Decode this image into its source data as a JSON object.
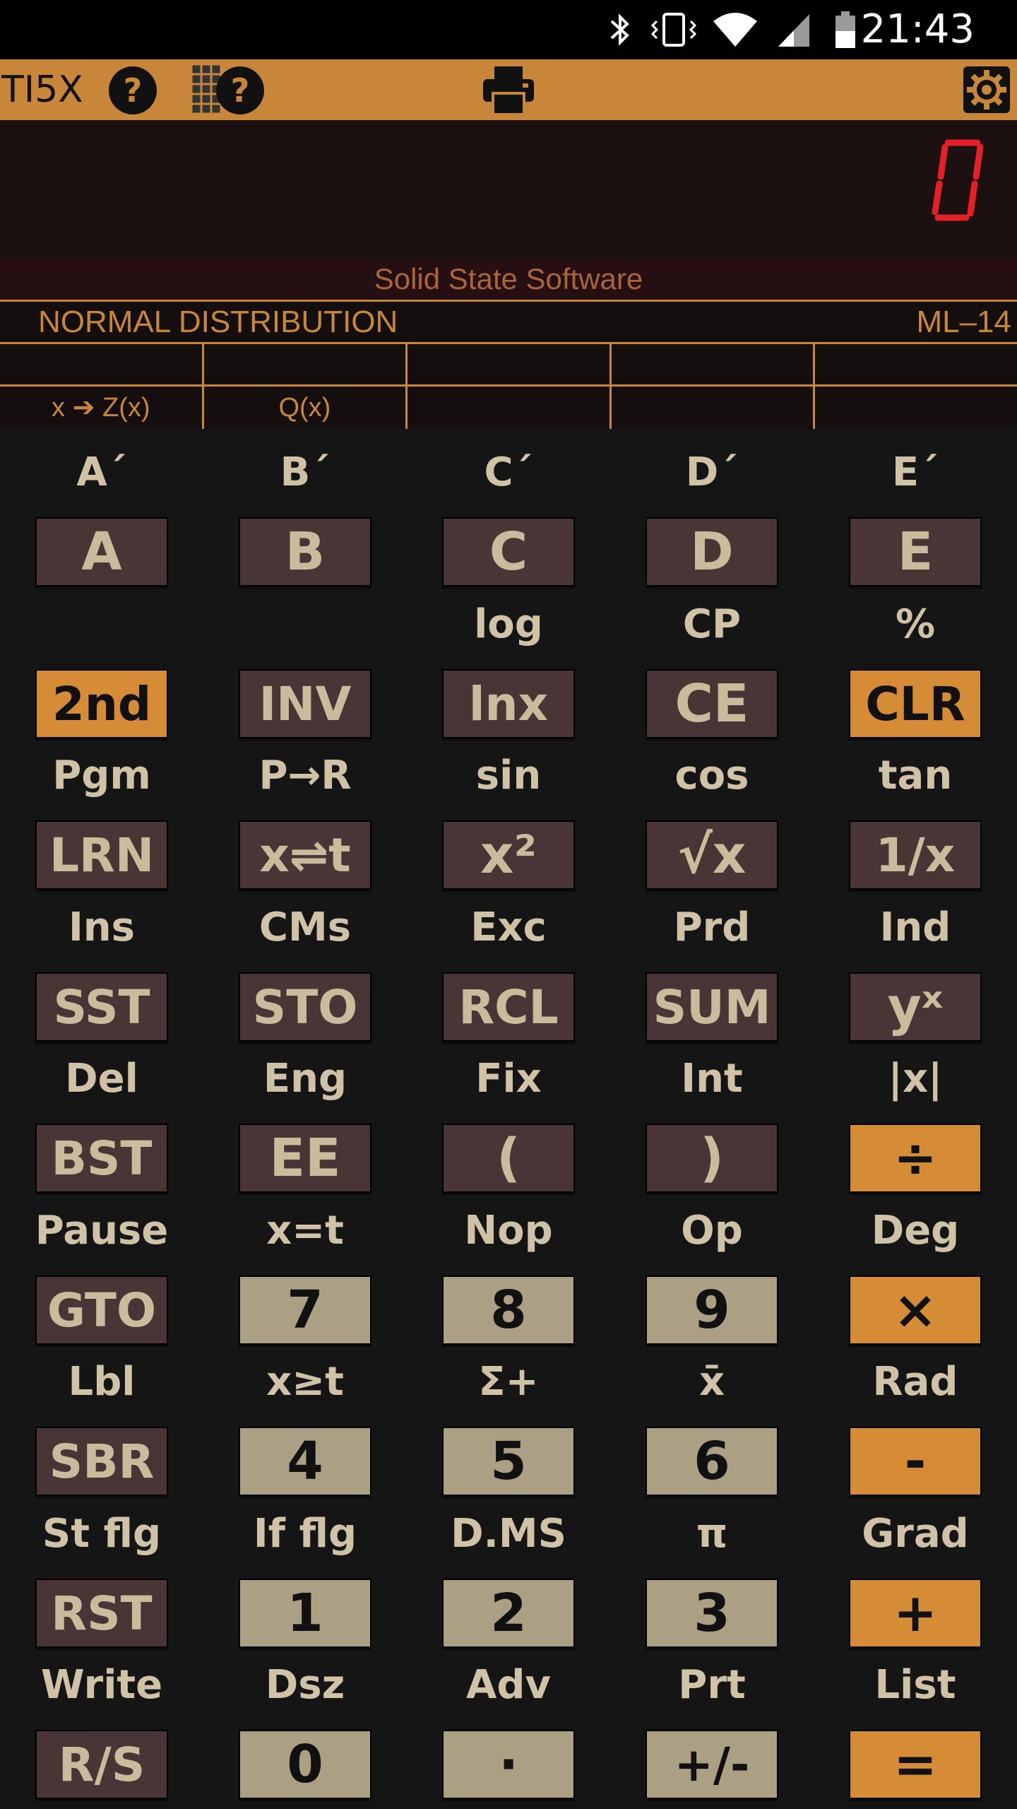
{
  "status_bar": {
    "time": "21:43",
    "icons": [
      "bluetooth-icon",
      "vibrate-icon",
      "wifi-icon",
      "cell-signal-icon",
      "battery-icon"
    ]
  },
  "toolbar": {
    "app_name": "TI5X",
    "icons": [
      "help-icon",
      "keypad-help-icon",
      "print-icon",
      "gear-icon"
    ]
  },
  "display": {
    "value": "0",
    "digit_color": "#e3202a"
  },
  "brand": "Solid State Software",
  "label_strip": {
    "title": "NORMAL DISTRIBUTION",
    "code": "ML–14",
    "row1": [
      "",
      "",
      "",
      "",
      ""
    ],
    "row2": [
      "x ➔ Z(x)",
      "Q(x)",
      "",
      "",
      ""
    ]
  },
  "keypad": {
    "rows": [
      {
        "labels": [
          "A´",
          "B´",
          "C´",
          "D´",
          "E´"
        ],
        "keys": [
          {
            "t": "A",
            "s": "dark"
          },
          {
            "t": "B",
            "s": "dark"
          },
          {
            "t": "C",
            "s": "dark"
          },
          {
            "t": "D",
            "s": "dark"
          },
          {
            "t": "E",
            "s": "dark"
          }
        ]
      },
      {
        "labels": [
          "",
          "",
          "log",
          "CP",
          "%"
        ],
        "keys": [
          {
            "t": "2nd",
            "s": "orange"
          },
          {
            "t": "INV",
            "s": "dark"
          },
          {
            "t": "lnx",
            "s": "dark"
          },
          {
            "t": "CE",
            "s": "dark"
          },
          {
            "t": "CLR",
            "s": "orange"
          }
        ]
      },
      {
        "labels": [
          "Pgm",
          "P→R",
          "sin",
          "cos",
          "tan"
        ],
        "keys": [
          {
            "t": "LRN",
            "s": "dark"
          },
          {
            "t": "x⇌t",
            "s": "dark"
          },
          {
            "t": "x²",
            "s": "dark"
          },
          {
            "t": "√x",
            "s": "dark"
          },
          {
            "t": "1/x",
            "s": "dark"
          }
        ]
      },
      {
        "labels": [
          "Ins",
          "CMs",
          "Exc",
          "Prd",
          "Ind"
        ],
        "keys": [
          {
            "t": "SST",
            "s": "dark"
          },
          {
            "t": "STO",
            "s": "dark"
          },
          {
            "t": "RCL",
            "s": "dark"
          },
          {
            "t": "SUM",
            "s": "dark"
          },
          {
            "t": "yˣ",
            "s": "dark"
          }
        ]
      },
      {
        "labels": [
          "Del",
          "Eng",
          "Fix",
          "Int",
          "|x|"
        ],
        "keys": [
          {
            "t": "BST",
            "s": "dark"
          },
          {
            "t": "EE",
            "s": "dark"
          },
          {
            "t": "(",
            "s": "dark"
          },
          {
            "t": ")",
            "s": "dark"
          },
          {
            "t": "÷",
            "s": "orange"
          }
        ]
      },
      {
        "labels": [
          "Pause",
          "x=t",
          "Nop",
          "Op",
          "Deg"
        ],
        "keys": [
          {
            "t": "GTO",
            "s": "dark"
          },
          {
            "t": "7",
            "s": "light"
          },
          {
            "t": "8",
            "s": "light"
          },
          {
            "t": "9",
            "s": "light"
          },
          {
            "t": "×",
            "s": "orange"
          }
        ]
      },
      {
        "labels": [
          "Lbl",
          "x≥t",
          "Σ+",
          "x̄",
          "Rad"
        ],
        "keys": [
          {
            "t": "SBR",
            "s": "dark"
          },
          {
            "t": "4",
            "s": "light"
          },
          {
            "t": "5",
            "s": "light"
          },
          {
            "t": "6",
            "s": "light"
          },
          {
            "t": "-",
            "s": "orange"
          }
        ]
      },
      {
        "labels": [
          "St flg",
          "If flg",
          "D.MS",
          "π",
          "Grad"
        ],
        "keys": [
          {
            "t": "RST",
            "s": "dark"
          },
          {
            "t": "1",
            "s": "light"
          },
          {
            "t": "2",
            "s": "light"
          },
          {
            "t": "3",
            "s": "light"
          },
          {
            "t": "+",
            "s": "orange"
          }
        ]
      },
      {
        "labels": [
          "Write",
          "Dsz",
          "Adv",
          "Prt",
          "List"
        ],
        "keys": [
          {
            "t": "R/S",
            "s": "dark"
          },
          {
            "t": "0",
            "s": "light"
          },
          {
            "t": "·",
            "s": "light"
          },
          {
            "t": "+/-",
            "s": "light"
          },
          {
            "t": "=",
            "s": "orange"
          }
        ]
      }
    ]
  }
}
